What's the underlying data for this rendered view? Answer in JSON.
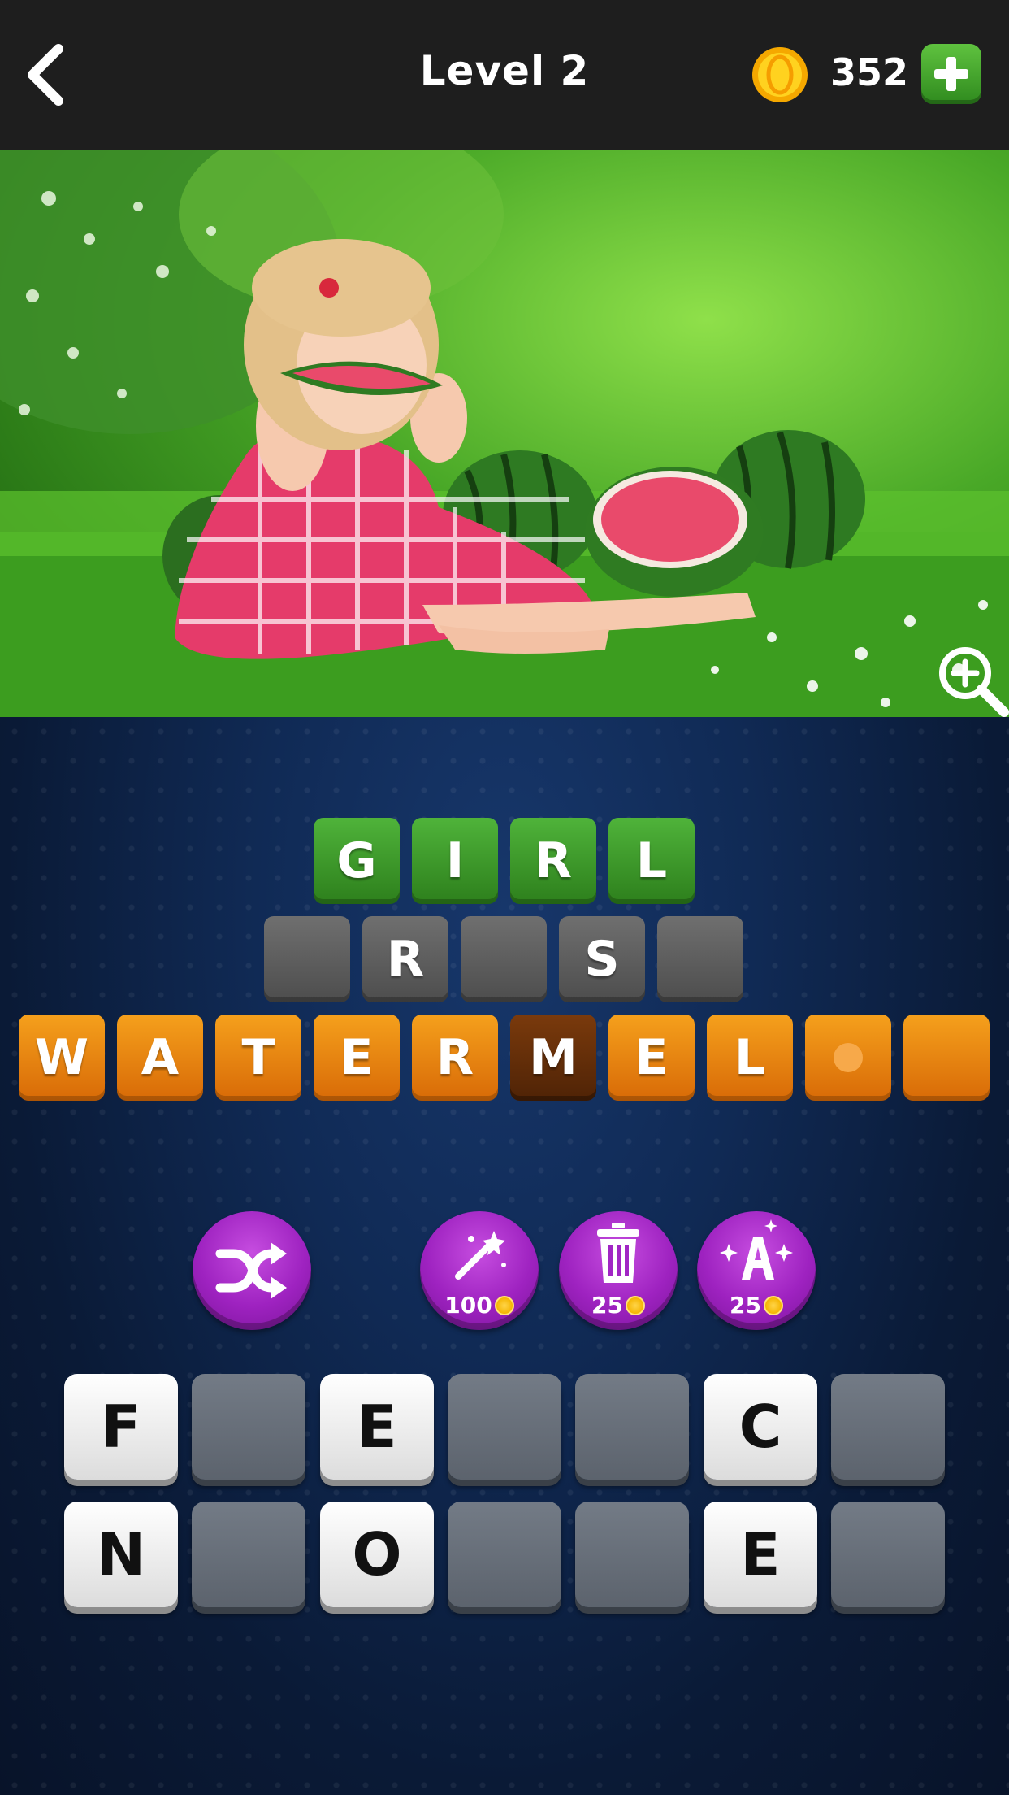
{
  "header": {
    "title": "Level 2",
    "coins": "352",
    "back_icon": "chevron-left-icon",
    "coin_icon": "coin-icon",
    "add_icon": "plus-icon"
  },
  "photo": {
    "zoom_icon": "zoom-in-icon"
  },
  "answers": {
    "row1": [
      "G",
      "I",
      "R",
      "L"
    ],
    "row2": [
      "",
      "R",
      "",
      "S",
      ""
    ],
    "row3": [
      "W",
      "A",
      "T",
      "E",
      "R",
      "M",
      "E",
      "L",
      "",
      ""
    ]
  },
  "powerups": {
    "shuffle": {
      "icon": "shuffle-icon"
    },
    "magic": {
      "icon": "magic-wand-icon",
      "cost": "100"
    },
    "remove": {
      "icon": "trash-icon",
      "cost": "25"
    },
    "reveal": {
      "icon": "reveal-letter-icon",
      "cost": "25"
    }
  },
  "keyboard": {
    "row1": [
      "F",
      "",
      "E",
      "",
      "",
      "C",
      ""
    ],
    "row2": [
      "N",
      "",
      "O",
      "",
      "",
      "E",
      ""
    ]
  },
  "colors": {
    "green": "#3a9a28",
    "orange": "#ee8a12",
    "purple": "#a126c4",
    "header": "#1e1e1e"
  }
}
